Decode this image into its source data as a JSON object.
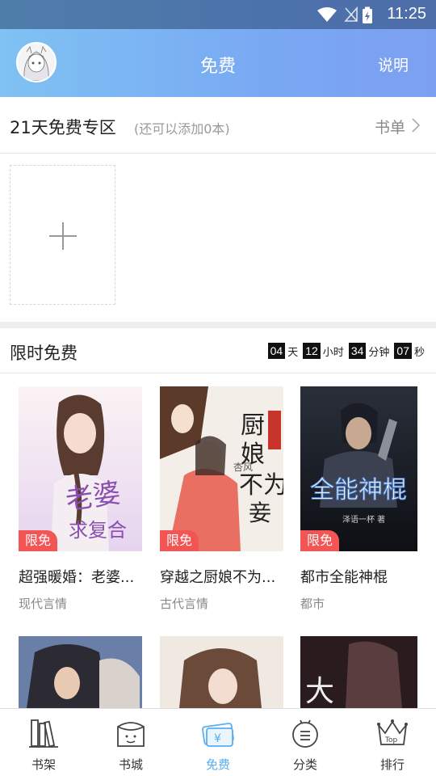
{
  "status_bar": {
    "time": "11:25"
  },
  "header": {
    "title": "免费",
    "right_link": "说明"
  },
  "free_zone": {
    "title": "21天免费专区",
    "subtitle": "(还可以添加0本)",
    "link": "书单"
  },
  "limited": {
    "title": "限时免费",
    "countdown": [
      {
        "num": "04",
        "unit": "天"
      },
      {
        "num": "12",
        "unit": "小时"
      },
      {
        "num": "34",
        "unit": "分钟"
      },
      {
        "num": "07",
        "unit": "秒"
      }
    ],
    "badge": "限免",
    "books": [
      {
        "title": "超强暖婚：老婆...",
        "category": "现代言情"
      },
      {
        "title": "穿越之厨娘不为...",
        "category": "古代言情"
      },
      {
        "title": "都市全能神棍",
        "category": "都市"
      }
    ]
  },
  "nav": [
    {
      "label": "书架",
      "icon": "bookshelf-icon"
    },
    {
      "label": "书城",
      "icon": "bookstore-icon"
    },
    {
      "label": "免费",
      "icon": "free-ticket-icon"
    },
    {
      "label": "分类",
      "icon": "category-icon"
    },
    {
      "label": "排行",
      "icon": "ranking-crown-icon"
    }
  ],
  "colors": {
    "accent": "#5aaef0",
    "badge": "#f35454",
    "header_start": "#7fc2f3",
    "header_end": "#7c9ff2"
  }
}
